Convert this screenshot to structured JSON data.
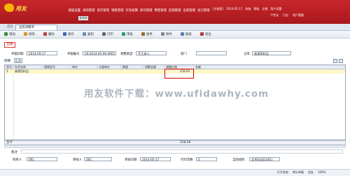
{
  "logo": {
    "text": "用友"
  },
  "menu": [
    "基础设置",
    "采购管理",
    "库存管理",
    "销售管理",
    "存货核算",
    "库存管理",
    "零售管理",
    "促销管理",
    "出库管理",
    "进口管理",
    "综合库管",
    "库存管理",
    "工资管理",
    "条码管理"
  ],
  "submenu": "其他单据",
  "top_right": [
    "[主账套]",
    "2014-05-17",
    "系统",
    "帮助",
    "注销",
    "用户设置"
  ],
  "top_right2": [
    "个性化",
    "日志",
    "用户管理"
  ],
  "tabs": {
    "home": "首页",
    "doc": "出库调整单"
  },
  "toolbar": [
    "增加",
    "修改",
    "删除",
    "保存",
    "复制",
    "打印",
    "审核",
    "放弃",
    "附件",
    "联查",
    "退出"
  ],
  "doc_title": "出库",
  "header": {
    "date_label": "单据日期",
    "date_value": "2014-05-17",
    "no_label": "单据编号",
    "no_value": "CK-2014-05-00-0001",
    "type_label": "调整类型",
    "type_value": "手工录入",
    "dept_label": "部门",
    "dept_value": "",
    "wh_label": "仓库",
    "wh_value": "普通用料品"
  },
  "detail": {
    "tab": "明细",
    "summary_btn": "汇总"
  },
  "grid": {
    "columns": [
      "序号",
      "存货名称",
      "规格型号",
      "单位",
      "计量单位",
      "数量",
      "调整金额",
      "调整价格",
      "金额"
    ],
    "row_index": "1",
    "row_name": "普通用料品",
    "row_amount": "258.00"
  },
  "total": {
    "label": "合计",
    "amount": "258.00"
  },
  "watermark": "用友软件下载：www.ufidawhy.com",
  "footer": {
    "remark_label": "备注",
    "maker_label": "制单人",
    "maker_value": "001",
    "auditor_label": "审核人",
    "auditor_value": "001",
    "audit_date_label": "审核日期",
    "audit_date_value": "2014-05-17",
    "print_label": "打印次数",
    "print_value": "0",
    "org_label": "当前组织",
    "org_value": "北京总部(1401)"
  },
  "status": {
    "items": [
      "打开状态",
      "审计单据",
      "用友"
    ],
    "zoom": "100%"
  }
}
